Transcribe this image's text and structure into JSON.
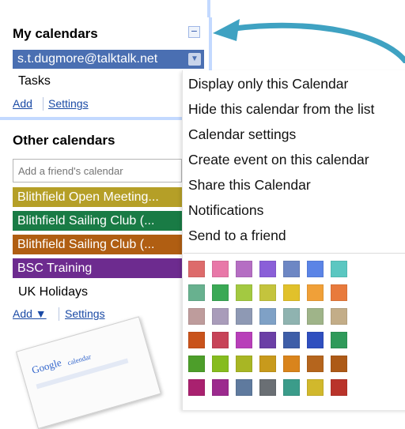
{
  "my_calendars": {
    "title": "My calendars",
    "collapse_icon": "minus-square-icon",
    "account": "s.t.dugmore@talktalk.net",
    "items": [
      "Tasks"
    ],
    "add_label": "Add",
    "settings_label": "Settings"
  },
  "other_calendars": {
    "title": "Other calendars",
    "friend_placeholder": "Add a friend's calendar",
    "calendars": [
      {
        "label": "Blithfield Open Meeting...",
        "color": "#b59f27"
      },
      {
        "label": "Blithfield Sailing Club (...",
        "color": "#197b45"
      },
      {
        "label": "Blithfield Sailing Club (...",
        "color": "#b05e12"
      },
      {
        "label": "BSC Training",
        "color": "#6d2b8f"
      },
      {
        "label": "UK Holidays",
        "color": ""
      }
    ],
    "add_label": "Add ▼",
    "settings_label": "Settings"
  },
  "context_menu": {
    "items": [
      "Display only this Calendar",
      "Hide this calendar from the list",
      "Calendar settings",
      "Create event on this calendar",
      "Share this Calendar",
      "Notifications",
      "Send to a friend"
    ],
    "color_swatches": [
      [
        "#dd6b6b",
        "#e878a8",
        "#b56ec3",
        "#8a5fd8",
        "#6d87c4",
        "#5b84e6",
        "#5bc7c1"
      ],
      [
        "#68b18f",
        "#3aa955",
        "#a3c941",
        "#c4c43d",
        "#e1c12b",
        "#f0a038",
        "#e87a3c"
      ],
      [
        "#be9c9c",
        "#a99cba",
        "#8e99b4",
        "#7fa1c6",
        "#8fb3b0",
        "#9fb489",
        "#c3ad88"
      ],
      [
        "#c9531b",
        "#c74358",
        "#b83fb9",
        "#6b3fa6",
        "#3e5ea8",
        "#2f4fbf",
        "#2f9a5a"
      ],
      [
        "#4d9e2a",
        "#86bc1f",
        "#a8b624",
        "#c89a1c",
        "#d9841c",
        "#b5651d",
        "#ad5a17"
      ],
      [
        "#a9216f",
        "#9c2a8e",
        "#5f7a9e",
        "#6a6f74",
        "#3b9c8a",
        "#d1b82c",
        "#b9332a"
      ]
    ]
  },
  "thumbnail": {
    "logo": "Google",
    "logo_sub": "calendar"
  },
  "colors": {
    "account_bg": "#4a6fb2",
    "accent_arrow": "#3fa2c2",
    "link": "#1a4aa5",
    "panel_border": "#c3d9ff"
  }
}
